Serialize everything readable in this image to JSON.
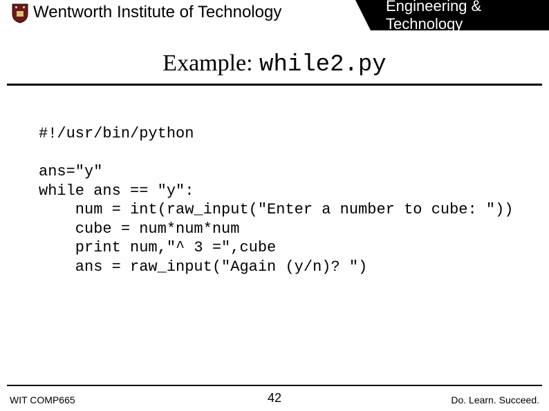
{
  "header": {
    "institution": "Wentworth Institute of Technology",
    "department": "Engineering & Technology"
  },
  "title": {
    "label": "Example:",
    "filename": "while2.py"
  },
  "code": {
    "line1": "#!/usr/bin/python",
    "line2": "",
    "line3": "ans=\"y\"",
    "line4": "while ans == \"y\":",
    "line5": "    num = int(raw_input(\"Enter a number to cube: \"))",
    "line6": "    cube = num*num*num",
    "line7": "    print num,\"^ 3 =\",cube",
    "line8": "    ans = raw_input(\"Again (y/n)? \")"
  },
  "footer": {
    "course": "WIT COMP665",
    "page": "42",
    "motto": "Do. Learn. Succeed."
  }
}
